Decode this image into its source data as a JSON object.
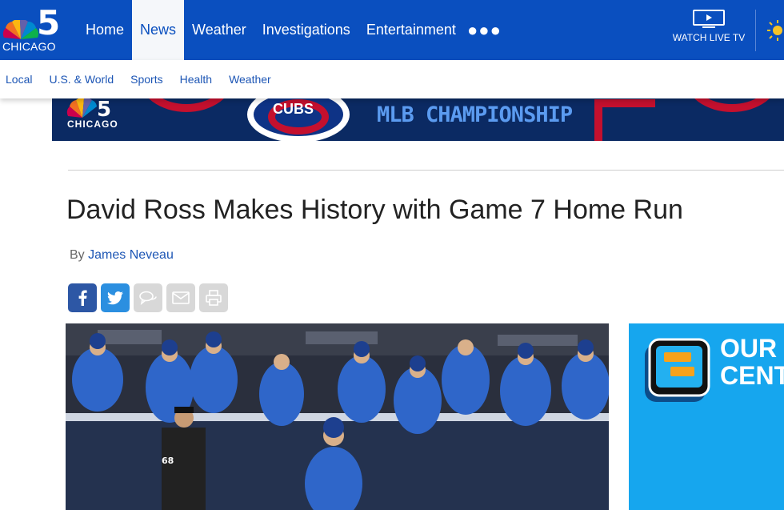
{
  "brand": {
    "channel_number": "5",
    "city": "CHICAGO",
    "colors": {
      "primary": "#0a4fbf",
      "link": "#1d56b5",
      "active_tab_bg": "#f5f7fa"
    }
  },
  "main_nav": {
    "items": [
      {
        "label": "Home",
        "active": false
      },
      {
        "label": "News",
        "active": true
      },
      {
        "label": "Weather",
        "active": false
      },
      {
        "label": "Investigations",
        "active": false
      },
      {
        "label": "Entertainment",
        "active": false
      }
    ],
    "more_icon": "ellipsis-icon"
  },
  "watch_live": {
    "label": "WATCH LIVE TV",
    "icon": "tv-play-icon"
  },
  "weather_icon": "sun-icon",
  "sub_nav": {
    "items": [
      "Local",
      "U.S. & World",
      "Sports",
      "Health",
      "Weather"
    ]
  },
  "banner": {
    "city": "CHICAGO",
    "cubs_text": "CUBS",
    "headline": "MLB CHAMPIONSHIP"
  },
  "article": {
    "title": "David Ross Makes History with Game 7 Home Run",
    "byline_prefix": "By",
    "author": "James Neveau"
  },
  "share_buttons": [
    {
      "name": "facebook",
      "icon": "facebook-icon"
    },
    {
      "name": "twitter",
      "icon": "twitter-icon"
    },
    {
      "name": "comments",
      "icon": "comment-icon"
    },
    {
      "name": "email",
      "icon": "email-icon"
    },
    {
      "name": "print",
      "icon": "print-icon"
    }
  ],
  "photo": {
    "jersey_number": "68"
  },
  "ad": {
    "text_line1": "OUR",
    "text_line2": "CENT"
  }
}
